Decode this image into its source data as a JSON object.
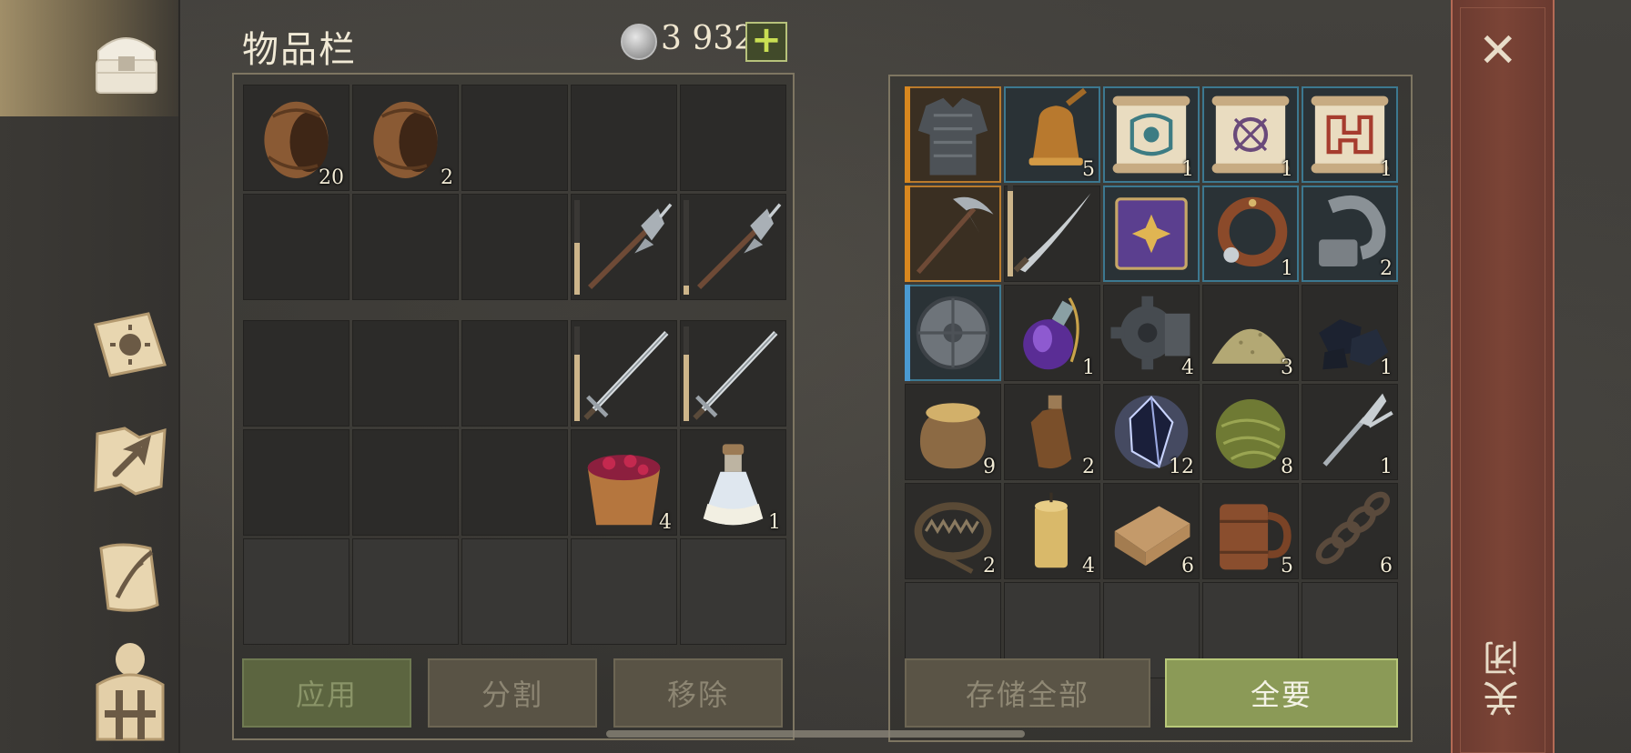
{
  "header": {
    "title": "物品栏",
    "currency_value": "3 932",
    "add_label": "+"
  },
  "inventory": {
    "top_rows": [
      [
        {
          "icon": "barrel-icon",
          "count": "20"
        },
        {
          "icon": "barrel-icon",
          "count": "2"
        },
        {},
        {},
        {}
      ],
      [
        {},
        {},
        {},
        {
          "icon": "halberd-icon",
          "durability": 0.55
        },
        {
          "icon": "halberd-icon",
          "durability": 0.1
        }
      ]
    ],
    "bottom_rows": [
      [
        {},
        {},
        {},
        {
          "icon": "sword-icon",
          "durability": 0.7
        },
        {
          "icon": "sword-icon",
          "durability": 0.7
        }
      ],
      [
        {},
        {},
        {},
        {
          "icon": "berry-bucket-icon",
          "count": "4"
        },
        {
          "icon": "milk-bottle-icon",
          "count": "1"
        }
      ],
      [
        {},
        {},
        {},
        {},
        {}
      ]
    ]
  },
  "storage": {
    "rows": [
      [
        {
          "icon": "chainmail-armor-icon",
          "rarity": "orange"
        },
        {
          "icon": "bell-icon",
          "count": "5",
          "frame": "blue"
        },
        {
          "icon": "blue-scroll-icon",
          "count": "1",
          "frame": "blue"
        },
        {
          "icon": "purple-scroll-icon",
          "count": "1",
          "frame": "blue"
        },
        {
          "icon": "red-scroll-icon",
          "count": "1",
          "frame": "blue"
        }
      ],
      [
        {
          "icon": "pickaxe-icon",
          "rarity": "orange"
        },
        {
          "icon": "scimitar-icon",
          "durability": 0.9
        },
        {
          "icon": "purple-book-icon",
          "frame": "blue"
        },
        {
          "icon": "leather-collar-icon",
          "count": "1",
          "frame": "blue"
        },
        {
          "icon": "shackle-icon",
          "count": "2",
          "frame": "blue"
        }
      ],
      [
        {
          "icon": "round-shield-icon",
          "rarity": "blue"
        },
        {
          "icon": "purple-potion-icon",
          "count": "1"
        },
        {
          "icon": "gear-icon",
          "count": "4"
        },
        {
          "icon": "sand-pile-icon",
          "count": "3"
        },
        {
          "icon": "coal-icon",
          "count": "1"
        }
      ],
      [
        {
          "icon": "grain-sack-icon",
          "count": "9"
        },
        {
          "icon": "flask-icon",
          "count": "2"
        },
        {
          "icon": "crystal-icon",
          "count": "12"
        },
        {
          "icon": "fiber-ball-icon",
          "count": "8"
        },
        {
          "icon": "fork-icon",
          "count": "1"
        }
      ],
      [
        {
          "icon": "bear-trap-icon",
          "count": "2"
        },
        {
          "icon": "candle-icon",
          "count": "4"
        },
        {
          "icon": "cloth-icon",
          "count": "6"
        },
        {
          "icon": "mug-icon",
          "count": "5"
        },
        {
          "icon": "chain-icon",
          "count": "6"
        }
      ],
      [
        {},
        {},
        {},
        {},
        {}
      ]
    ]
  },
  "buttons": {
    "apply": "应用",
    "split": "分割",
    "remove": "移除",
    "store_all": "存储全部",
    "take_all": "全要"
  },
  "close": {
    "label": "关闭",
    "x": "✕"
  },
  "colors": {
    "accent_green": "#8b9a57",
    "rare_orange": "#d8871f",
    "rare_blue": "#4a9ad1",
    "close_bg": "#7b4436"
  }
}
